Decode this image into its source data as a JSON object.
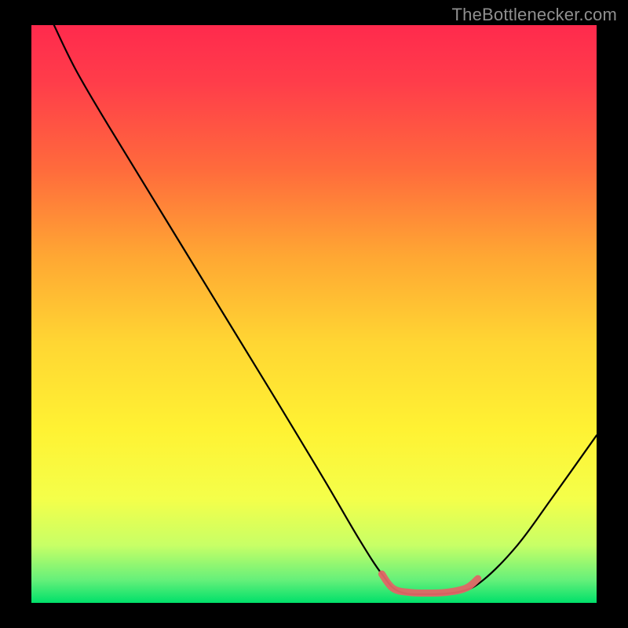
{
  "watermark": "TheBottlenecker.com",
  "chart_data": {
    "type": "line",
    "title": "",
    "xlabel": "",
    "ylabel": "",
    "xlim": [
      0,
      100
    ],
    "ylim": [
      0,
      100
    ],
    "gradient_stops": [
      {
        "offset": 0.0,
        "color": "#ff2a4d"
      },
      {
        "offset": 0.1,
        "color": "#ff3d4a"
      },
      {
        "offset": 0.25,
        "color": "#ff6b3c"
      },
      {
        "offset": 0.4,
        "color": "#ffa733"
      },
      {
        "offset": 0.55,
        "color": "#ffd633"
      },
      {
        "offset": 0.7,
        "color": "#fff233"
      },
      {
        "offset": 0.82,
        "color": "#f4ff4a"
      },
      {
        "offset": 0.9,
        "color": "#c8ff66"
      },
      {
        "offset": 0.96,
        "color": "#66f07a"
      },
      {
        "offset": 1.0,
        "color": "#00e06a"
      }
    ],
    "series": [
      {
        "name": "bottleneck-curve",
        "stroke": "#000000",
        "width": 2.2,
        "points": [
          {
            "x": 4.0,
            "y": 100.0
          },
          {
            "x": 8.0,
            "y": 92.0
          },
          {
            "x": 14.0,
            "y": 82.0
          },
          {
            "x": 24.0,
            "y": 66.0
          },
          {
            "x": 34.0,
            "y": 50.0
          },
          {
            "x": 44.0,
            "y": 34.0
          },
          {
            "x": 52.0,
            "y": 21.0
          },
          {
            "x": 58.0,
            "y": 11.0
          },
          {
            "x": 62.0,
            "y": 5.0
          },
          {
            "x": 65.0,
            "y": 2.0
          },
          {
            "x": 70.0,
            "y": 1.5
          },
          {
            "x": 76.0,
            "y": 2.0
          },
          {
            "x": 80.0,
            "y": 4.0
          },
          {
            "x": 86.0,
            "y": 10.0
          },
          {
            "x": 92.0,
            "y": 18.0
          },
          {
            "x": 100.0,
            "y": 29.0
          }
        ]
      }
    ],
    "highlight": {
      "name": "optimal-zone",
      "stroke": "#e06666",
      "width": 9,
      "linecap": "round",
      "points": [
        {
          "x": 62.0,
          "y": 5.0
        },
        {
          "x": 64.0,
          "y": 2.5
        },
        {
          "x": 67.0,
          "y": 1.8
        },
        {
          "x": 71.0,
          "y": 1.7
        },
        {
          "x": 74.0,
          "y": 1.9
        },
        {
          "x": 77.0,
          "y": 2.6
        },
        {
          "x": 79.0,
          "y": 4.2
        }
      ]
    }
  }
}
